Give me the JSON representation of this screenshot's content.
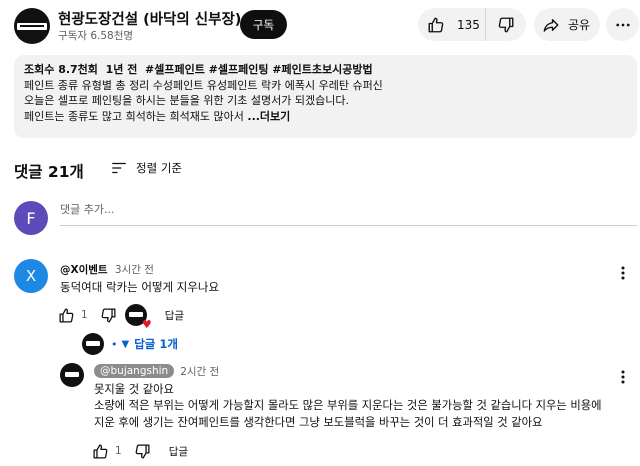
{
  "channel": {
    "name": "현광도장건설 (바닥의 신부장)",
    "subscribers": "구독자 6.58천명",
    "subscribe_label": "구독"
  },
  "actions": {
    "like_count": "135",
    "share_label": "공유"
  },
  "description": {
    "views": "조회수 8.7천회",
    "age": "1년 전",
    "hashtags": "#셀프페인트 #셀프페인팅 #페인트초보시공방법",
    "line2": "페인트 종류 유형별 총 정리 수성페인트 유성페인트 락카 에폭시 우레탄 슈퍼신",
    "line3": "오늘은 셀프로 페인팅을 하시는 분들을 위한 기초 설명서가 되겠습니다.",
    "line4": "페인트는 종류도 많고 희석하는 희석재도 많아서",
    "more_label": "...더보기"
  },
  "comments_header": {
    "count_label": "댓글 21개",
    "sort_label": "정렬 기준"
  },
  "add_comment": {
    "avatar_letter": "F",
    "placeholder": "댓글 추가..."
  },
  "comment": {
    "avatar_letter": "X",
    "author": "@X이벤트",
    "time": "3시간 전",
    "text": "동덕여대 락카는 어떻게 지우나요",
    "like_count": "1",
    "reply_label": "답글"
  },
  "replies_toggle": {
    "label": "답글 1개"
  },
  "reply": {
    "author": "@bujangshin",
    "time": "2시간 전",
    "line1": "못지울 것 같아요",
    "line2": "소량에 적은 부위는 어떻게 가능할지 몰라도 많은 부위를 지운다는 것은 불가능할 것 같습니다 지우는 비용에",
    "line3": "지운 후에 생기는 잔여페인트를 생각한다면 그냥 보도블럭을 바꾸는 것이 더 효과적일 것 같아요",
    "like_count": "1",
    "reply_label": "답글"
  },
  "colors": {
    "link_blue": "#065fd4",
    "pill_gray": "#f2f2f2",
    "add_avatar": "#5c4bb8",
    "comment_avatar": "#1e88e5",
    "heart_red": "#e31b23"
  },
  "icons": [
    "thumb-up-icon",
    "thumb-down-icon",
    "share-icon",
    "more-icon",
    "sort-icon",
    "chevron-down-icon",
    "heart-icon"
  ]
}
